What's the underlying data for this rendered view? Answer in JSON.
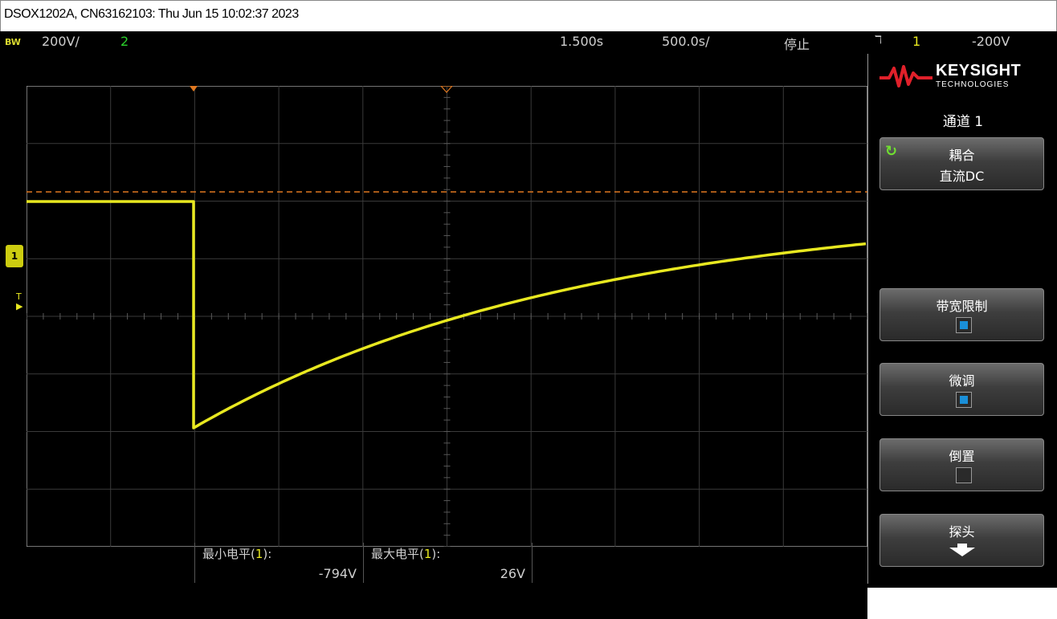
{
  "window": {
    "title": "DSOX1202A, CN63162103: Thu Jun 15 10:02:37 2023"
  },
  "status_bar": {
    "bw_label": "BW",
    "ch1_scale": "200V/",
    "ch2_indicator": "2",
    "time_delay": "1.500s",
    "time_base": "500.0s/",
    "run_state": "停止",
    "trigger_icon": "trigger-edge-icon",
    "trigger_symbol": "ℸ",
    "trigger_channel": "1",
    "trigger_level": "-200V"
  },
  "display": {
    "ch1_marker": "1",
    "trigger_marker": "T",
    "trace_color": "#e8e820",
    "trigger_level_line_color": "#e07820",
    "time_marker_color": "#e07820"
  },
  "measurements": [
    {
      "label_prefix": "最小电平(",
      "channel": "1",
      "label_suffix": "):",
      "value": "-794V"
    },
    {
      "label_prefix": "最大电平(",
      "channel": "1",
      "label_suffix": "):",
      "value": "26V"
    }
  ],
  "side_panel": {
    "brand": "KEYSIGHT",
    "brand_sub": "TECHNOLOGIES",
    "menu_title": "通道 1",
    "softkeys": [
      {
        "label": "耦合",
        "value": "直流DC",
        "icon": "coupling-cycle-icon"
      },
      {
        "label": "带宽限制",
        "checked": true
      },
      {
        "label": "微调",
        "checked": true
      },
      {
        "label": "倒置",
        "checked": false
      },
      {
        "label": "探头",
        "icon": "arrow-down-icon"
      }
    ]
  }
}
